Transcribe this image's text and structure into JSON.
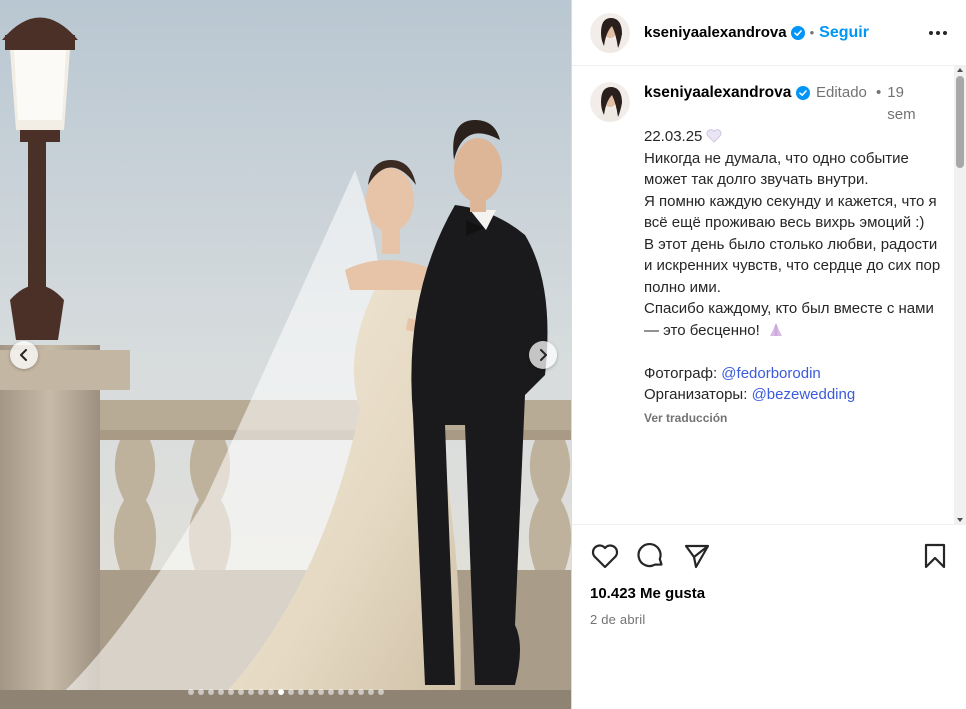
{
  "post": {
    "username": "kseniyaalexandrova",
    "follow_label": "Seguir",
    "separator": "•",
    "caption": {
      "username": "kseniyaalexandrova",
      "edited_label": "Editado",
      "time_ago": "19 sem",
      "date_line": "22.03.25",
      "paragraphs": [
        "Никогда не думала, что одно событие может так долго звучать внутри.",
        "Я помню каждую секунду и кажется, что я всё ещё проживаю весь вихрь эмоций :)",
        "В этот день было столько любви, радости и искренних чувств, что сердце до сих пор полно ими.",
        "Спасибо каждому, кто был вместе с нами — это бесценно!"
      ],
      "photographer_label": "Фотограф:",
      "photographer_handle": "@fedorborodin",
      "organizers_label": "Организаторы:",
      "organizers_handle": "@bezewedding",
      "translate_label": "Ver traducción"
    },
    "likes": "10.423 Me gusta",
    "date": "2 de abril",
    "carousel": {
      "total": 20,
      "active_index": 9
    },
    "icons": [
      "heart-icon",
      "comment-icon",
      "share-icon",
      "bookmark-icon",
      "more-icon",
      "verified-icon",
      "chevron-left-icon",
      "chevron-right-icon"
    ],
    "colors": {
      "accent": "#0095f6",
      "verified": "#0095f6",
      "link": "#3b5bdb",
      "muted": "#737373"
    }
  }
}
